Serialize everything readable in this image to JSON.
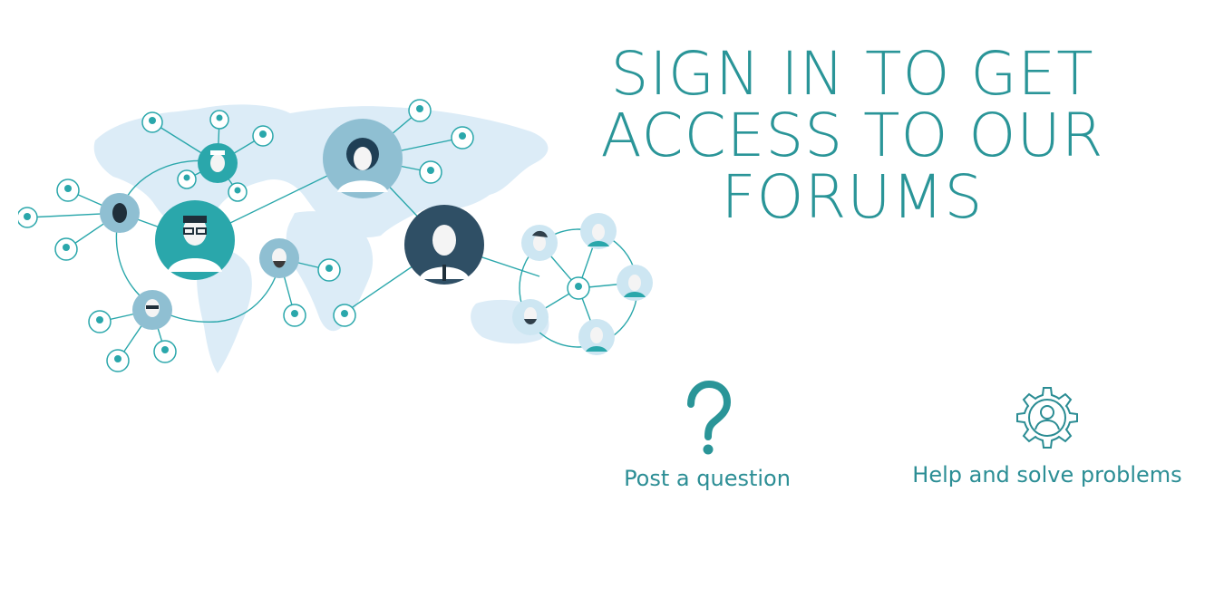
{
  "headline": {
    "line1": "SIGN IN TO GET",
    "line2": "ACCESS TO OUR",
    "line3": "FORUMS"
  },
  "features": {
    "post_question": {
      "label": "Post a question",
      "icon": "question-mark-icon"
    },
    "help_solve": {
      "label": "Help and solve problems",
      "icon": "gear-user-icon"
    }
  },
  "illustration": {
    "icon": "world-network-illustration"
  },
  "colors": {
    "accent": "#2a9598",
    "map": "#dcecf7",
    "node_light": "#8fbfd2",
    "node_dark": "#2f4f65",
    "node_teal": "#2aa7ab"
  }
}
